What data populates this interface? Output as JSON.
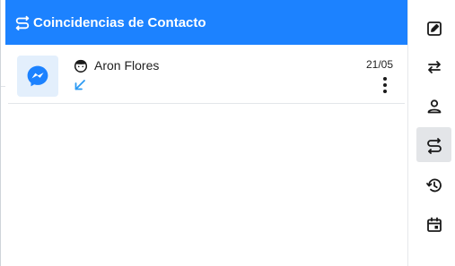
{
  "header": {
    "title": "Coincidencias de Contacto",
    "icon": "swap-route-icon",
    "color": "#1c82ff"
  },
  "match": {
    "channel_icon": "messenger-icon",
    "channel_color": "#1c82ff",
    "avatar_icon": "user-face-icon",
    "name": "Aron Flores",
    "direction_icon": "arrow-down-left-icon",
    "direction_color": "#2b9af3",
    "date": "21/05",
    "menu_icon": "more-vertical-icon"
  },
  "sidebar": {
    "items": [
      {
        "icon": "edit-icon",
        "active": false
      },
      {
        "icon": "transfer-arrows-icon",
        "active": false
      },
      {
        "icon": "person-icon",
        "active": false
      },
      {
        "icon": "swap-route-icon",
        "active": true
      },
      {
        "icon": "history-icon",
        "active": false
      },
      {
        "icon": "calendar-event-icon",
        "active": false
      }
    ]
  }
}
